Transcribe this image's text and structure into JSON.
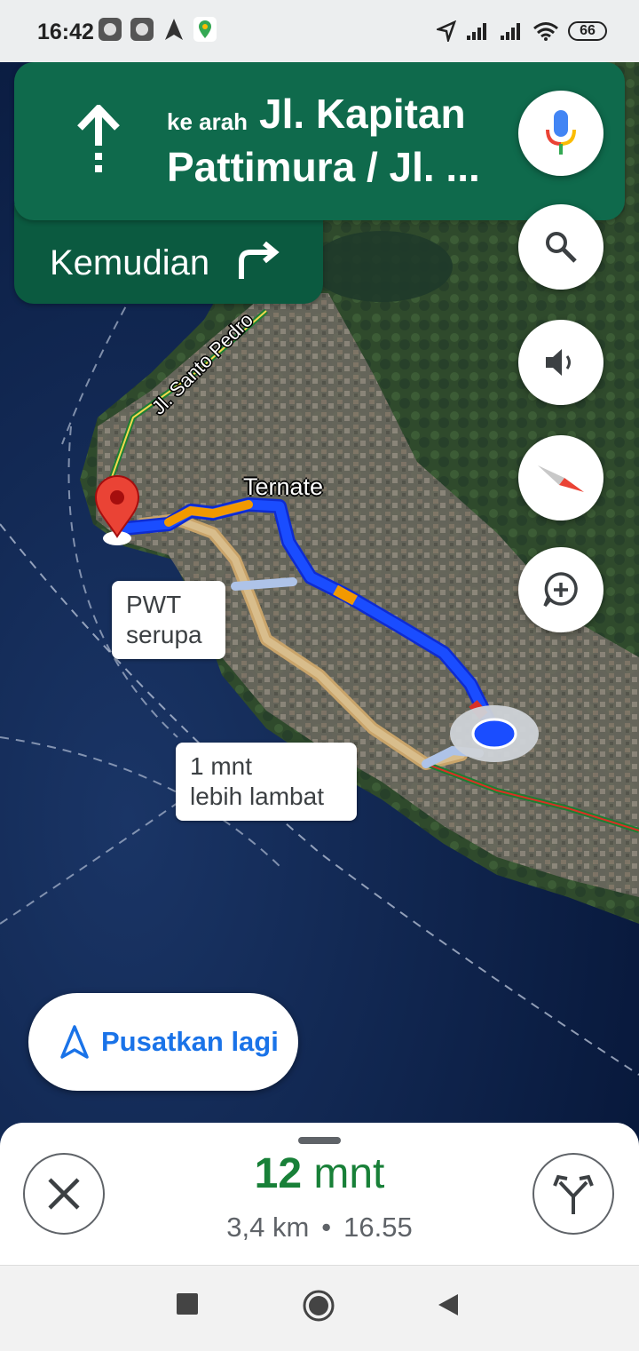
{
  "status_bar": {
    "time": "16:42",
    "battery": "66",
    "left_icons": [
      "notification-icon",
      "notification-icon",
      "navigation-arrow-icon",
      "maps-icon"
    ],
    "right_icons": [
      "location-icon",
      "signal-icon",
      "signal-icon",
      "wifi-icon",
      "battery-icon"
    ]
  },
  "banner": {
    "prefix": "ke arah",
    "street": "Jl. Kapitan Pattimura / Jl. ...",
    "icon": "straight-arrow-icon",
    "color": "#0f6a4c"
  },
  "next_step": {
    "label": "Kemudian",
    "icon": "turn-right-icon"
  },
  "map_labels": {
    "street": "Jl. Santo Pedro",
    "city": "Ternate",
    "alt_route_1": {
      "line1": "PWT",
      "line2": "serupa"
    },
    "alt_route_2": {
      "line1": "1 mnt",
      "line2": "lebih lambat"
    }
  },
  "side_buttons": [
    "microphone-icon",
    "search-icon",
    "volume-icon",
    "compass-icon",
    "add-report-icon"
  ],
  "recenter": {
    "label": "Pusatkan lagi",
    "icon": "navigation-arrow-icon"
  },
  "trip": {
    "eta_value": "12",
    "eta_unit": "mnt",
    "distance": "3,4 km",
    "separator": "•",
    "arrival": "16.55",
    "color": "#188038"
  },
  "nav_bar": [
    "recents-icon",
    "home-icon",
    "back-icon"
  ],
  "colors": {
    "route_primary": "#1a4dff",
    "route_traffic": "#f29900",
    "route_alt": "#d2b48c",
    "accent": "#1a73e8"
  }
}
